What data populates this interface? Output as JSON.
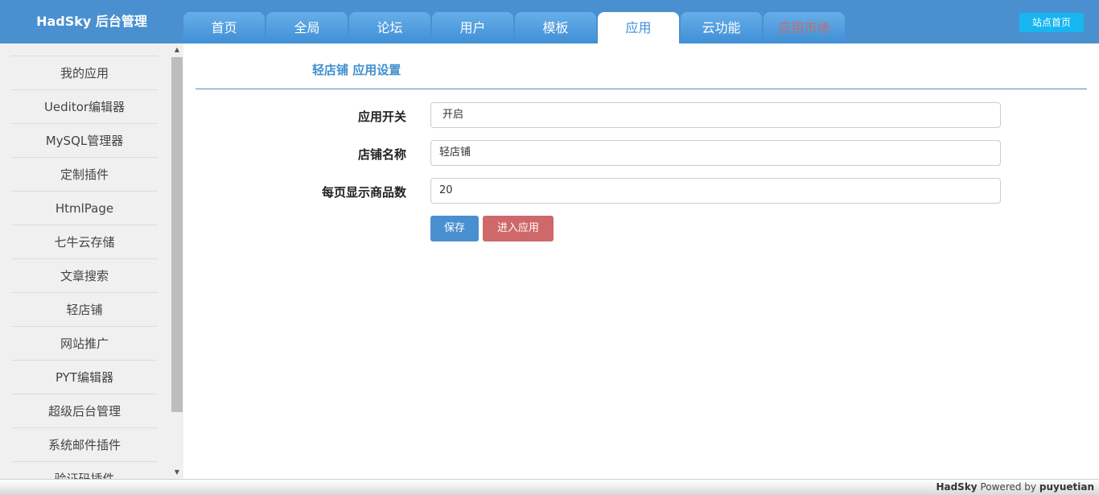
{
  "header": {
    "brand": "HadSky 后台管理",
    "site_home": "站点首页",
    "tabs": [
      {
        "label": "首页"
      },
      {
        "label": "全局"
      },
      {
        "label": "论坛"
      },
      {
        "label": "用户"
      },
      {
        "label": "模板"
      },
      {
        "label": "应用",
        "active": true
      },
      {
        "label": "云功能"
      },
      {
        "label": "应用市场"
      }
    ],
    "colors": {
      "bar": "#4a90d0",
      "active_tab_text": "#3c8ed7",
      "market_tab_text": "#c86a6a",
      "site_home_bg": "#17b6f0"
    }
  },
  "sidebar": {
    "items": [
      {
        "label": "我的应用"
      },
      {
        "label": "Ueditor编辑器"
      },
      {
        "label": "MySQL管理器"
      },
      {
        "label": "定制插件"
      },
      {
        "label": "HtmlPage"
      },
      {
        "label": "七牛云存储"
      },
      {
        "label": "文章搜索"
      },
      {
        "label": "轻店铺"
      },
      {
        "label": "网站推广"
      },
      {
        "label": "PYT编辑器"
      },
      {
        "label": "超级后台管理"
      },
      {
        "label": "系统邮件插件"
      },
      {
        "label": "验证码插件"
      }
    ],
    "scroll_up_icon": "triangle-up-icon",
    "scroll_down_icon": "triangle-down-icon"
  },
  "main": {
    "title": "轻店铺 应用设置",
    "fields": [
      {
        "label": "应用开关",
        "value": "开启",
        "type": "select"
      },
      {
        "label": "店铺名称",
        "value": "轻店铺",
        "type": "text"
      },
      {
        "label": "每页显示商品数",
        "value": "20",
        "type": "text"
      }
    ],
    "buttons": {
      "save": "保存",
      "enter": "进入应用"
    },
    "colors": {
      "title": "#3d8fd1",
      "save": "#4a8fd0",
      "enter": "#cf6868"
    }
  },
  "footer": {
    "brand": "HadSky",
    "powered": "Powered by",
    "author": "puyuetian"
  }
}
